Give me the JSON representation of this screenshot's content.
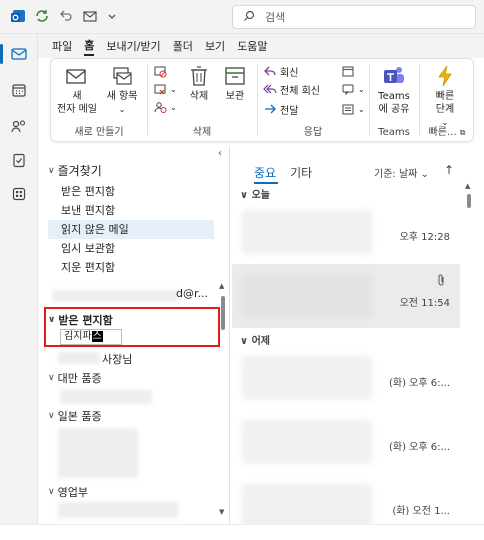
{
  "titlebar": {
    "search_placeholder": "검색",
    "qat": [
      "outlook-logo-icon",
      "sync-icon",
      "undo-icon",
      "mail-icon",
      "chevron-down-icon"
    ]
  },
  "rail": [
    "mail-icon",
    "calendar-icon",
    "people-icon",
    "tasks-icon",
    "apps-icon"
  ],
  "ribbon_tabs": [
    "파일",
    "홈",
    "보내기/받기",
    "폴더",
    "보기",
    "도움말"
  ],
  "ribbon": {
    "new_group": {
      "label": "새로 만들기",
      "new_email": [
        "새",
        "전자 메일"
      ],
      "new_items": [
        "새 항목"
      ]
    },
    "delete_group": {
      "label": "삭제",
      "delete": "삭제",
      "archive": "보관"
    },
    "respond_group": {
      "label": "응답",
      "reply": "회신",
      "reply_all": "전체 회신",
      "forward": "전달"
    },
    "teams_group": {
      "label": "Teams",
      "share": [
        "Teams",
        "에 공유"
      ]
    },
    "quick_group": {
      "label": "빠른...",
      "quick_steps": [
        "빠른",
        "단계"
      ]
    }
  },
  "folders": {
    "favorites_title": "즐겨찾기",
    "favorites": [
      "받은 편지함",
      "보낸 편지함",
      "읽지 않은 메일",
      "임시 보관함",
      "지운 편지함"
    ],
    "account_suffix": "d@r...",
    "inbox_title": "받은 편지함",
    "rename_value_prefix": "김지파",
    "rename_value_cursor": "스",
    "subfolder_suffix": "사장님",
    "groups": [
      "대만 품증",
      "일본 품증",
      "영업부"
    ]
  },
  "message_list": {
    "tabs": [
      "중요",
      "기타"
    ],
    "sort_label": "기준: 날짜",
    "group_today": "오늘",
    "group_yesterday": "어제",
    "messages": [
      {
        "time": "오후 12:28"
      },
      {
        "time": "오전 11:54"
      },
      {
        "time": "(화) 오후 6:..."
      },
      {
        "time": "(화) 오후 6:..."
      },
      {
        "time": "(화) 오전 1..."
      }
    ]
  },
  "colors": {
    "accent": "#0f6cbd",
    "highlight_outline": "#e01b1b",
    "selected_folder": "#e6eff8"
  }
}
